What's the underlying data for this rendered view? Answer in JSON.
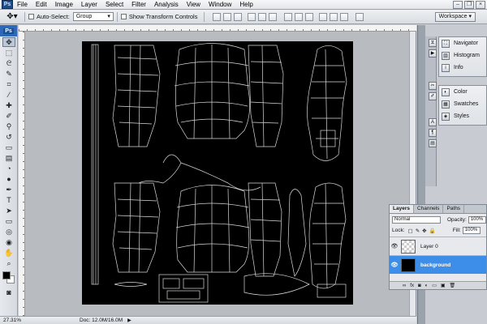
{
  "app": {
    "logo": "Ps"
  },
  "menu": [
    "File",
    "Edit",
    "Image",
    "Layer",
    "Select",
    "Filter",
    "Analysis",
    "View",
    "Window",
    "Help"
  ],
  "options": {
    "auto_select_label": "Auto-Select:",
    "auto_select_value": "Group",
    "show_transform_label": "Show Transform Controls",
    "workspace_label": "Workspace ▾"
  },
  "status": {
    "zoom": "27.31%",
    "doc": "Doc: 12.0M/16.0M"
  },
  "dock": {
    "group1": [
      "Navigator",
      "Histogram",
      "Info"
    ],
    "group2": [
      "Color",
      "Swatches",
      "Styles"
    ]
  },
  "layers_panel": {
    "tabs": [
      "Layers",
      "Channels",
      "Paths"
    ],
    "blend_mode": "Normal",
    "opacity_label": "Opacity:",
    "opacity_value": "100%",
    "lock_label": "Lock:",
    "fill_label": "Fill:",
    "fill_value": "100%",
    "layers": [
      {
        "name": "Layer 0",
        "selected": false
      },
      {
        "name": "background",
        "selected": true
      }
    ]
  },
  "colors": {
    "accent": "#3d8ee8",
    "canvas": "#000000",
    "ps_blue": "#1d4f8f"
  }
}
